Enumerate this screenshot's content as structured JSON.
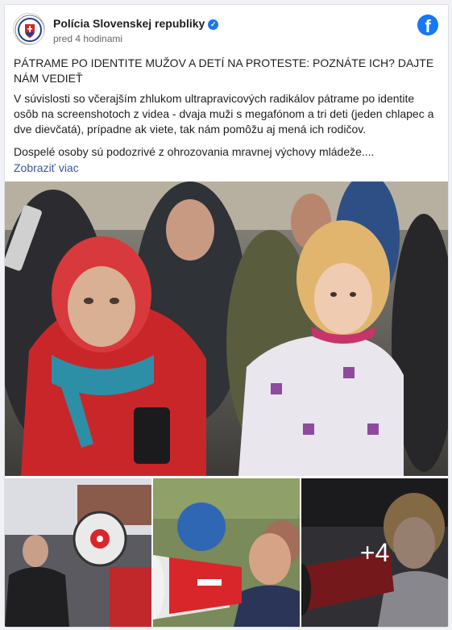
{
  "post": {
    "page_name": "Polícia Slovenskej republiky",
    "timestamp": "pred 4 hodinami",
    "verified_icon": "verified-check-icon",
    "platform_icon": "facebook-icon",
    "title": "PÁTRAME PO IDENTITE MUŽOV A DETÍ NA PROTESTE: POZNÁTE ICH? DAJTE NÁM VEDIEŤ",
    "body": "V súvislosti so včerajším zhlukom ultrapravicových radikálov pátrame po identite osôb na screenshotoch z videa - dvaja muži s megafónom a tri deti (jeden chlapec a dve dievčatá), prípadne ak viete, tak nám pomôžu aj mená ich rodičov.",
    "body2": "Dospelé osoby sú podozrivé z ohrozovania mravnej výchovy mládeže....",
    "see_more": "Zobraziť viac"
  },
  "photos": {
    "more_count": "+4"
  },
  "colors": {
    "link": "#385898",
    "brand": "#1877f2",
    "text": "#1c1e21",
    "meta": "#65676b"
  }
}
